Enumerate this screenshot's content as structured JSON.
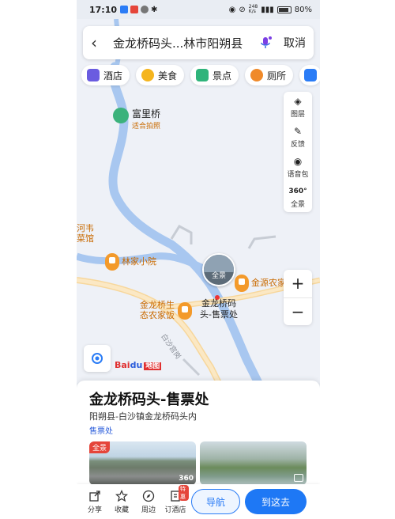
{
  "status_bar": {
    "time": "17:10",
    "network_speed": "248\nK/s",
    "battery": "80%"
  },
  "search": {
    "query": "金龙桥码头...林市阳朔县",
    "cancel_label": "取消"
  },
  "categories": [
    {
      "label": "酒店",
      "icon": "hotel-icon"
    },
    {
      "label": "美食",
      "icon": "food-icon"
    },
    {
      "label": "景点",
      "icon": "scenic-icon"
    },
    {
      "label": "厕所",
      "icon": "toilet-icon"
    }
  ],
  "tools": [
    {
      "label": "图层",
      "icon": "layers-icon"
    },
    {
      "label": "反馈",
      "icon": "feedback-icon"
    },
    {
      "label": "语音包",
      "icon": "voice-icon"
    },
    {
      "label": "全景",
      "icon": "panorama-360-icon",
      "mark": "360°"
    }
  ],
  "map_labels": {
    "fuli_bridge": "富里桥",
    "fuli_sub": "适合拍照",
    "hewei": "河韦",
    "caiguan": "菜馆",
    "linjia": "林家小院",
    "jinyuan": "金源农家",
    "shengtai_1": "金龙桥生",
    "shengtai_2": "态农家饭",
    "dest_1": "金龙桥码",
    "dest_2": "头-售票处",
    "pano_label": "全景",
    "road": "白沙宫岗"
  },
  "logo": {
    "text": "Bai",
    "paw": "du",
    "suffix": "地图"
  },
  "zoom": {
    "in": "+",
    "out": "−"
  },
  "place": {
    "title": "金龙桥码头-售票处",
    "address": "阳朔县-白沙镇金龙桥码头内",
    "type": "售票处",
    "photo_tag": "全景",
    "photo_360": "360"
  },
  "actions": [
    {
      "label": "分享",
      "icon": "share-icon"
    },
    {
      "label": "收藏",
      "icon": "star-icon"
    },
    {
      "label": "周边",
      "icon": "compass-icon"
    },
    {
      "label": "订酒店",
      "icon": "hotel-book-icon",
      "badge": "特惠"
    }
  ],
  "buttons": {
    "navigate": "导航",
    "go": "到这去"
  },
  "colors": {
    "accent": "#1e78f5",
    "poi": "#f39a2b",
    "river": "#a8c7f0"
  }
}
